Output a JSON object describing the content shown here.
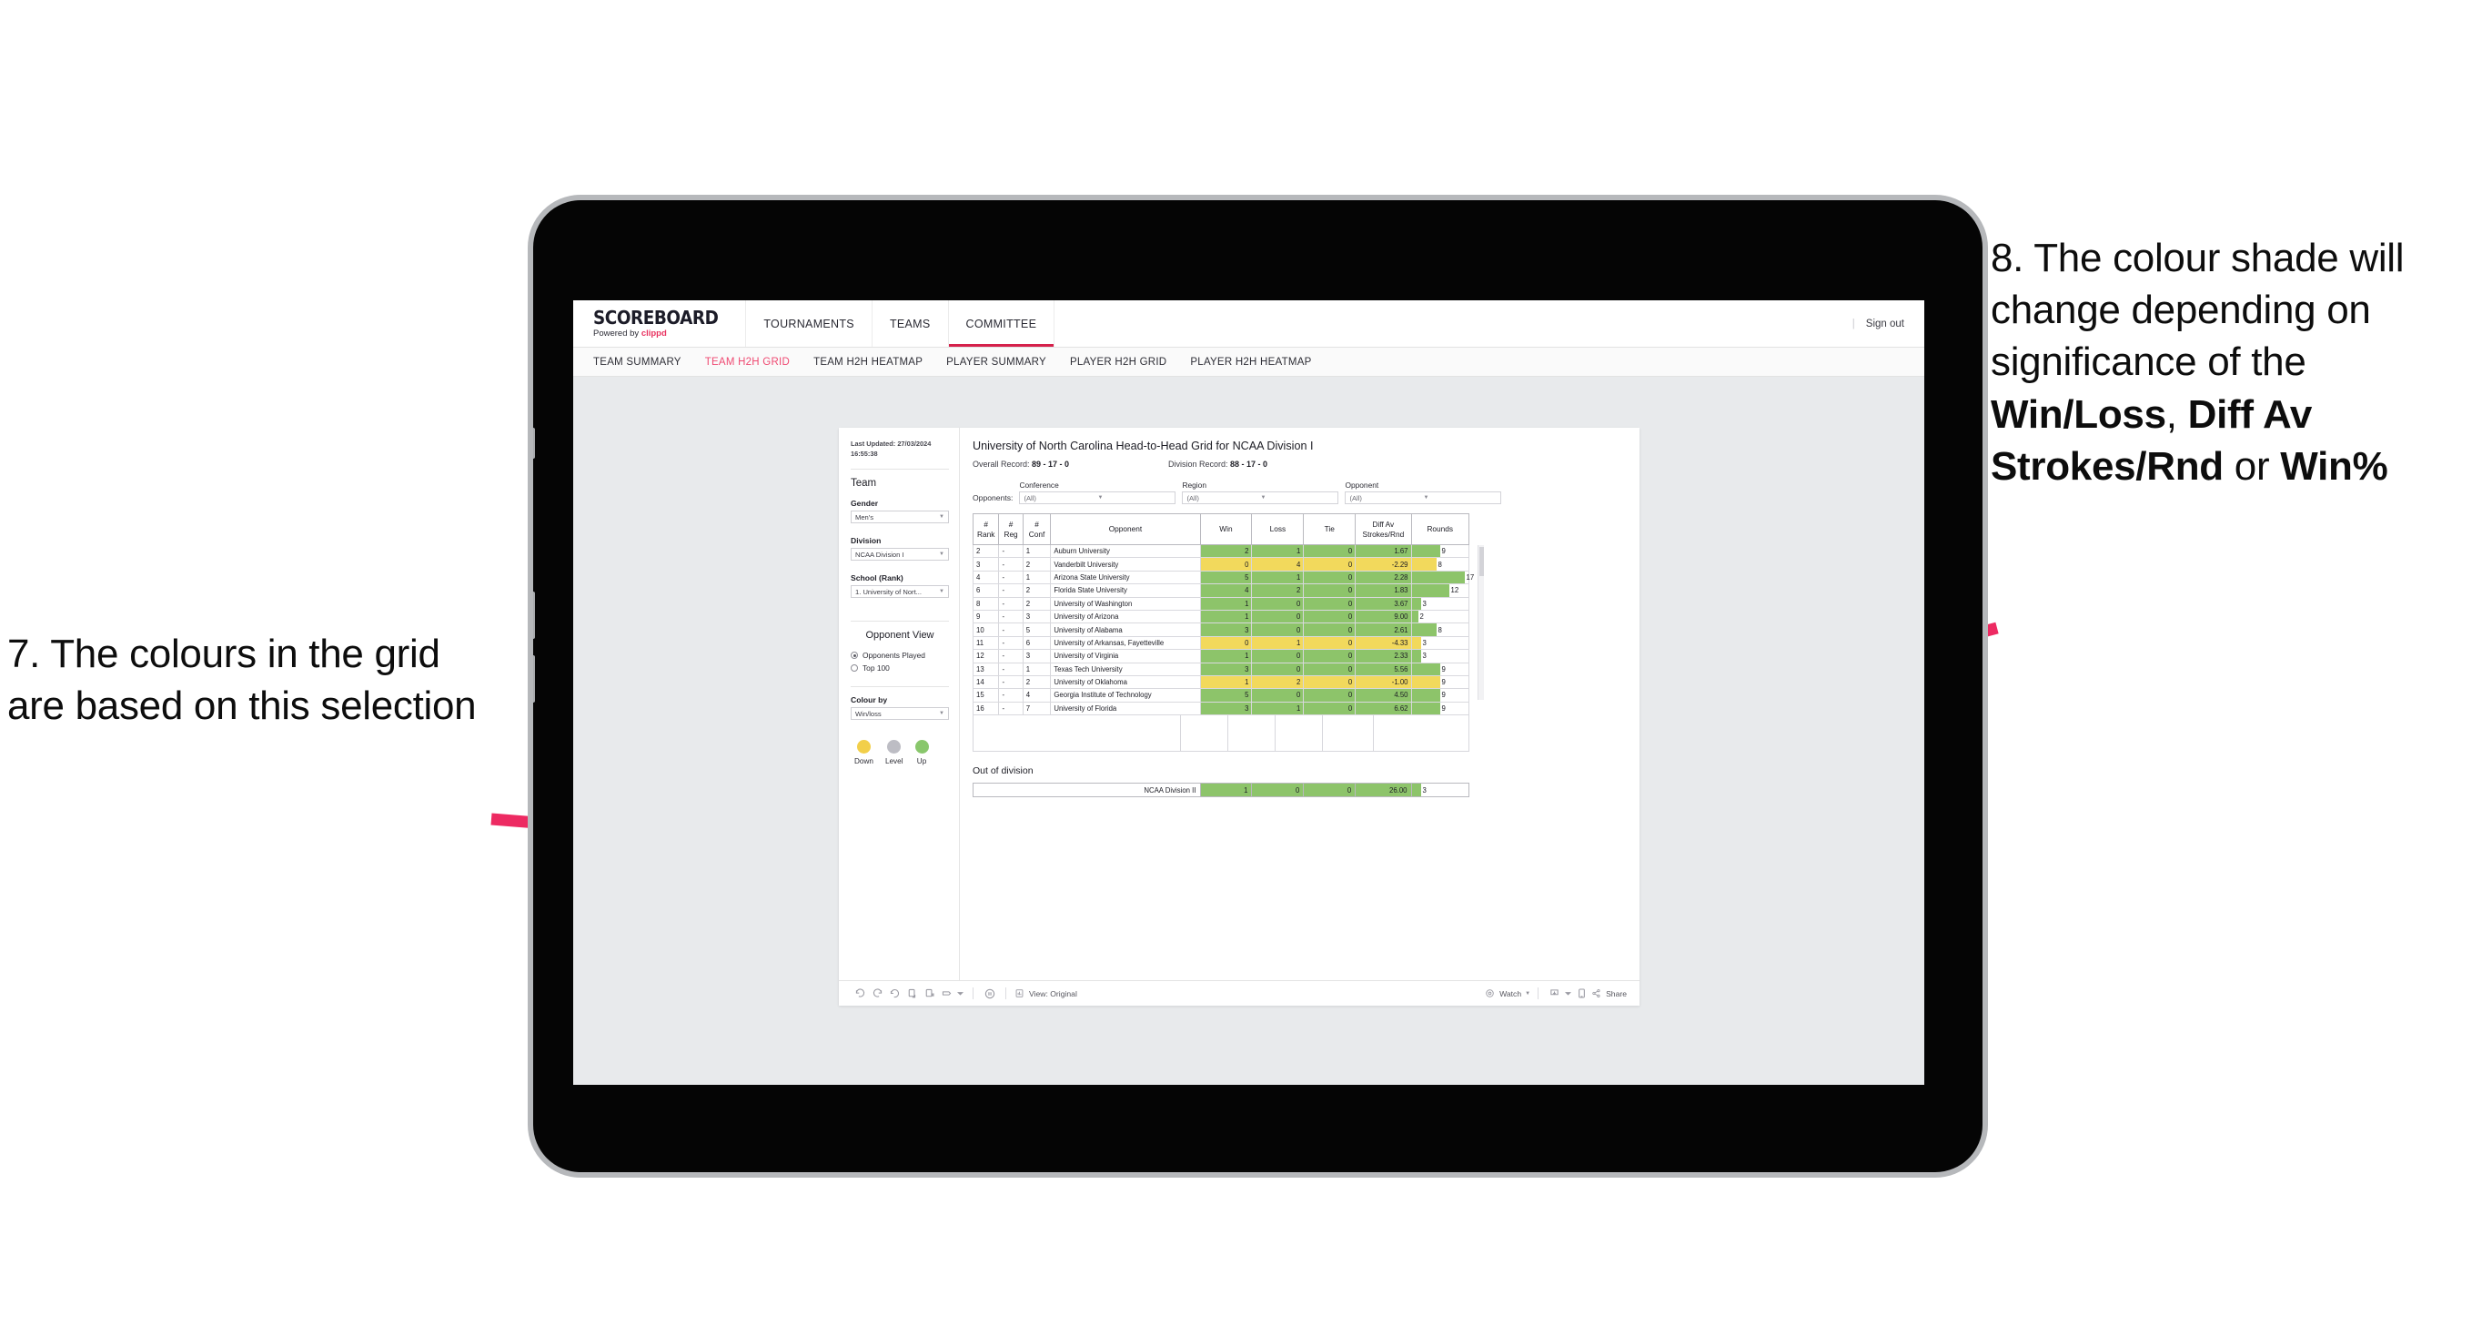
{
  "annotations": {
    "left": {
      "name": "annotation-7",
      "text": "7. The colours in the grid are based on this selection"
    },
    "right": {
      "name": "annotation-8",
      "prefix": "8. The colour shade will change depending on significance of the ",
      "bold1": "Win/Loss",
      "mid1": ", ",
      "bold2": "Diff Av Strokes/Rnd",
      "mid2": " or ",
      "bold3": "Win%"
    },
    "arrow_color": "#ED2A62"
  },
  "app": {
    "brand": {
      "name": "SCOREBOARD",
      "powered_prefix": "Powered by ",
      "powered_brand": "clippd"
    },
    "top_nav": [
      {
        "label": "TOURNAMENTS",
        "active": false
      },
      {
        "label": "TEAMS",
        "active": false
      },
      {
        "label": "COMMITTEE",
        "active": true
      }
    ],
    "sign_out": "Sign out",
    "separator": "|",
    "sub_nav": [
      {
        "label": "TEAM SUMMARY",
        "active": false
      },
      {
        "label": "TEAM H2H GRID",
        "active": true
      },
      {
        "label": "TEAM H2H HEATMAP",
        "active": false
      },
      {
        "label": "PLAYER SUMMARY",
        "active": false
      },
      {
        "label": "PLAYER H2H GRID",
        "active": false
      },
      {
        "label": "PLAYER H2H HEATMAP",
        "active": false
      }
    ],
    "accent_pink": "#EF4A72",
    "accent_red": "#D5214B"
  },
  "sidebar": {
    "last_updated": "Last Updated: 27/03/2024 16:55:38",
    "team_heading": "Team",
    "gender_label": "Gender",
    "gender_value": "Men's",
    "division_label": "Division",
    "division_value": "NCAA Division I",
    "school_label": "School (Rank)",
    "school_value": "1. University of Nort...",
    "opponent_view_heading": "Opponent View",
    "opponent_view_options": [
      {
        "label": "Opponents Played",
        "selected": true
      },
      {
        "label": "Top 100",
        "selected": false
      }
    ],
    "colour_by_label": "Colour by",
    "colour_by_value": "Win/loss",
    "legend": [
      {
        "label": "Down",
        "color": "#F2CF4A"
      },
      {
        "label": "Level",
        "color": "#BDBDC4"
      },
      {
        "label": "Up",
        "color": "#89C76C"
      }
    ]
  },
  "main": {
    "title": "University of North Carolina Head-to-Head Grid for NCAA Division I",
    "overall_record_label": "Overall Record: ",
    "overall_record_value": "89 - 17 - 0",
    "division_record_label": "Division Record: ",
    "division_record_value": "88 - 17 - 0",
    "filters_label": "Opponents:",
    "filters": [
      {
        "label": "Conference",
        "value": "(All)"
      },
      {
        "label": "Region",
        "value": "(All)"
      },
      {
        "label": "Opponent",
        "value": "(All)"
      }
    ],
    "out_of_division_title": "Out of division"
  },
  "chart_data": {
    "type": "table",
    "title": "University of North Carolina Head-to-Head Grid for NCAA Division I",
    "columns": [
      "# Rank",
      "# Reg",
      "# Conf",
      "Opponent",
      "Win",
      "Loss",
      "Tie",
      "Diff Av Strokes/Rnd",
      "Rounds"
    ],
    "column_lines": [
      [
        "#",
        "Rank"
      ],
      [
        "#",
        "Reg"
      ],
      [
        "#",
        "Conf"
      ],
      [
        "",
        "Opponent"
      ],
      [
        "Win",
        ""
      ],
      [
        "Loss",
        ""
      ],
      [
        "Tie",
        ""
      ],
      [
        "Diff Av",
        "Strokes/Rnd"
      ],
      [
        "Rounds",
        ""
      ]
    ],
    "rounds_max": 17,
    "colors": {
      "up": "#8DC46A",
      "down": "#F2D95C",
      "level": "#BDBDC4"
    },
    "rows": [
      {
        "rank": "2",
        "reg": "-",
        "conf": "1",
        "opponent": "Auburn University",
        "win": "2",
        "loss": "1",
        "tie": "0",
        "diff": "1.67",
        "rounds": 9,
        "state": "up"
      },
      {
        "rank": "3",
        "reg": "-",
        "conf": "2",
        "opponent": "Vanderbilt University",
        "win": "0",
        "loss": "4",
        "tie": "0",
        "diff": "-2.29",
        "rounds": 8,
        "state": "down"
      },
      {
        "rank": "4",
        "reg": "-",
        "conf": "1",
        "opponent": "Arizona State University",
        "win": "5",
        "loss": "1",
        "tie": "0",
        "diff": "2.28",
        "rounds": 17,
        "state": "up"
      },
      {
        "rank": "6",
        "reg": "-",
        "conf": "2",
        "opponent": "Florida State University",
        "win": "4",
        "loss": "2",
        "tie": "0",
        "diff": "1.83",
        "rounds": 12,
        "state": "up"
      },
      {
        "rank": "8",
        "reg": "-",
        "conf": "2",
        "opponent": "University of Washington",
        "win": "1",
        "loss": "0",
        "tie": "0",
        "diff": "3.67",
        "rounds": 3,
        "state": "up"
      },
      {
        "rank": "9",
        "reg": "-",
        "conf": "3",
        "opponent": "University of Arizona",
        "win": "1",
        "loss": "0",
        "tie": "0",
        "diff": "9.00",
        "rounds": 2,
        "state": "up"
      },
      {
        "rank": "10",
        "reg": "-",
        "conf": "5",
        "opponent": "University of Alabama",
        "win": "3",
        "loss": "0",
        "tie": "0",
        "diff": "2.61",
        "rounds": 8,
        "state": "up"
      },
      {
        "rank": "11",
        "reg": "-",
        "conf": "6",
        "opponent": "University of Arkansas, Fayetteville",
        "win": "0",
        "loss": "1",
        "tie": "0",
        "diff": "-4.33",
        "rounds": 3,
        "state": "down"
      },
      {
        "rank": "12",
        "reg": "-",
        "conf": "3",
        "opponent": "University of Virginia",
        "win": "1",
        "loss": "0",
        "tie": "0",
        "diff": "2.33",
        "rounds": 3,
        "state": "up"
      },
      {
        "rank": "13",
        "reg": "-",
        "conf": "1",
        "opponent": "Texas Tech University",
        "win": "3",
        "loss": "0",
        "tie": "0",
        "diff": "5.56",
        "rounds": 9,
        "state": "up"
      },
      {
        "rank": "14",
        "reg": "-",
        "conf": "2",
        "opponent": "University of Oklahoma",
        "win": "1",
        "loss": "2",
        "tie": "0",
        "diff": "-1.00",
        "rounds": 9,
        "state": "down"
      },
      {
        "rank": "15",
        "reg": "-",
        "conf": "4",
        "opponent": "Georgia Institute of Technology",
        "win": "5",
        "loss": "0",
        "tie": "0",
        "diff": "4.50",
        "rounds": 9,
        "state": "up"
      },
      {
        "rank": "16",
        "reg": "-",
        "conf": "7",
        "opponent": "University of Florida",
        "win": "3",
        "loss": "1",
        "tie": "0",
        "diff": "6.62",
        "rounds": 9,
        "state": "up"
      }
    ],
    "out_of_division": [
      {
        "label": "NCAA Division II",
        "win": "1",
        "loss": "0",
        "tie": "0",
        "diff": "26.00",
        "rounds": 3,
        "state": "up"
      }
    ]
  },
  "toolbar": {
    "view_label": "View: Original",
    "watch_label": "Watch",
    "share_label": "Share"
  }
}
